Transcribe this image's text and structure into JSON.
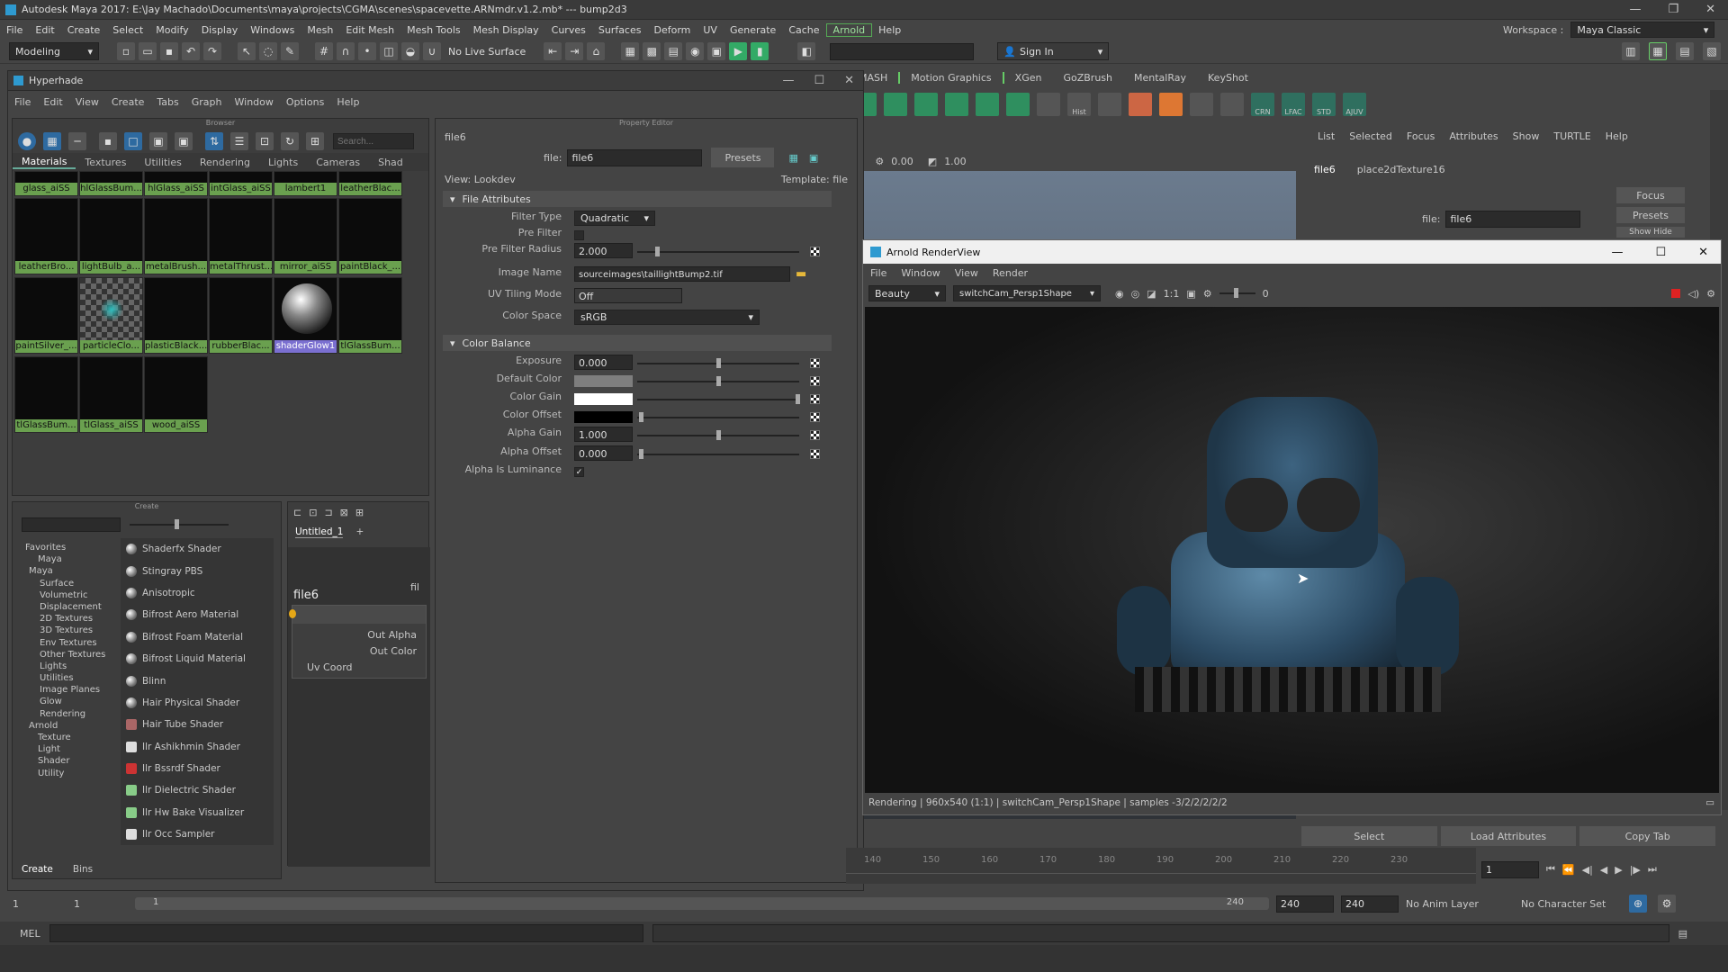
{
  "titlebar": {
    "title": "Autodesk Maya 2017: E:\\Jay Machado\\Documents\\maya\\projects\\CGMA\\scenes\\spacevette.ARNmdr.v1.2.mb*   ---   bump2d3"
  },
  "mainmenu": [
    "File",
    "Edit",
    "Create",
    "Select",
    "Modify",
    "Display",
    "Windows",
    "Mesh",
    "Edit Mesh",
    "Mesh Tools",
    "Mesh Display",
    "Curves",
    "Surfaces",
    "Deform",
    "UV",
    "Generate",
    "Cache",
    "Arnold",
    "Help"
  ],
  "statusline": {
    "mode": "Modeling",
    "live_surface": "No Live Surface",
    "sign_in": "Sign In",
    "workspace_label": "Workspace :",
    "workspace": "Maya Classic"
  },
  "shelf_tabs": [
    "MASH",
    "Motion Graphics",
    "XGen",
    "GoZBrush",
    "MentalRay",
    "KeyShot"
  ],
  "shelf_labels": [
    "Hist",
    "CRN",
    "LFAC",
    "STD",
    "AJUV"
  ],
  "hypershade": {
    "title": "Hyperhade",
    "menu": [
      "File",
      "Edit",
      "View",
      "Create",
      "Tabs",
      "Graph",
      "Window",
      "Options",
      "Help"
    ],
    "browser_label": "Browser",
    "search_placeholder": "Search...",
    "tabs": [
      "Materials",
      "Textures",
      "Utilities",
      "Rendering",
      "Lights",
      "Cameras",
      "Shad"
    ],
    "materials": [
      "glass_aiSS",
      "hlGlassBum...",
      "hlGlass_aiSS",
      "intGlass_aiSS",
      "lambert1",
      "leatherBlac...",
      "leatherBro...",
      "lightBulb_a...",
      "metalBrush...",
      "metalThrust...",
      "mirror_aiSS",
      "paintBlack_...",
      "paintSilver_...",
      "particleClo...",
      "plasticBlack...",
      "rubberBlac...",
      "shaderGlow1",
      "tlGlassBum...",
      "tlGlassBum...",
      "tlGlass_aiSS",
      "wood_aiSS"
    ],
    "create_label": "Create",
    "tree": [
      "Favorites",
      "Maya",
      "Maya",
      "Surface",
      "Volumetric",
      "Displacement",
      "2D Textures",
      "3D Textures",
      "Env Textures",
      "Other Textures",
      "Lights",
      "Utilities",
      "Image Planes",
      "Glow",
      "Rendering",
      "Arnold",
      "Texture",
      "Light",
      "Shader",
      "Utility"
    ],
    "shaders": [
      "Shaderfx Shader",
      "Stingray PBS",
      "Anisotropic",
      "Bifrost Aero Material",
      "Bifrost Foam Material",
      "Bifrost Liquid Material",
      "Blinn",
      "Hair Physical Shader",
      "Hair Tube Shader",
      "Ilr Ashikhmin Shader",
      "Ilr Bssrdf Shader",
      "Ilr Dielectric Shader",
      "Ilr Hw Bake Visualizer",
      "Ilr Occ Sampler"
    ],
    "bottom_tabs": [
      "Create",
      "Bins"
    ],
    "graph_tab": "Untitled_1",
    "node": {
      "name": "file6",
      "clip": "fil",
      "out_alpha": "Out Alpha",
      "out_color": "Out Color",
      "uv_coord": "Uv Coord"
    }
  },
  "property_editor": {
    "label": "Property Editor",
    "tab": "file6",
    "file_label": "file:",
    "file_value": "file6",
    "presets": "Presets",
    "view": "View: Lookdev",
    "template": "Template: file",
    "file_attributes": "File Attributes",
    "filter_type_label": "Filter Type",
    "filter_type": "Quadratic",
    "pre_filter_label": "Pre Filter",
    "pre_filter_radius_label": "Pre Filter Radius",
    "pre_filter_radius": "2.000",
    "image_name_label": "Image Name",
    "image_name": "sourceimages\\taillightBump2.tif",
    "uv_tiling_label": "UV Tiling Mode",
    "uv_tiling": "Off",
    "color_space_label": "Color Space",
    "color_space": "sRGB",
    "color_balance": "Color Balance",
    "exposure_label": "Exposure",
    "exposure": "0.000",
    "default_color_label": "Default Color",
    "color_gain_label": "Color Gain",
    "color_offset_label": "Color Offset",
    "alpha_gain_label": "Alpha Gain",
    "alpha_gain": "1.000",
    "alpha_offset_label": "Alpha Offset",
    "alpha_offset": "0.000",
    "alpha_is_luminance_label": "Alpha Is Luminance"
  },
  "viewport_bar": {
    "v1": "0.00",
    "v2": "1.00"
  },
  "attr_editor": {
    "menu": [
      "List",
      "Selected",
      "Focus",
      "Attributes",
      "Show",
      "TURTLE",
      "Help"
    ],
    "tab1": "file6",
    "tab2": "place2dTexture16",
    "file_label": "file:",
    "file_value": "file6",
    "focus": "Focus",
    "presets": "Presets",
    "show_hide": "Show   Hide",
    "select": "Select",
    "load_attributes": "Load Attributes",
    "copy_tab": "Copy Tab"
  },
  "renderview": {
    "title": "Arnold RenderView",
    "menu": [
      "File",
      "Window",
      "View",
      "Render"
    ],
    "aov": "Beauty",
    "camera": "switchCam_Persp1Shape",
    "ratio": "1:1",
    "exposure": "0",
    "status": "Rendering | 960x540 (1:1) | switchCam_Persp1Shape | samples -3/2/2/2/2/2"
  },
  "timeline": {
    "ticks": [
      "140",
      "150",
      "160",
      "170",
      "180",
      "190",
      "200",
      "210",
      "220",
      "230"
    ],
    "current_frame": "1",
    "range_start": "1",
    "range_start2": "1",
    "range_field": "1",
    "end1": "240",
    "end2": "240",
    "end3": "240",
    "anim_layer": "No Anim Layer",
    "character_set": "No Character Set"
  },
  "commandline": {
    "label": "MEL"
  },
  "colors": {
    "accent": "#5fb98a",
    "material_label": "#6aa04f",
    "selected_label": "#7a6fd0",
    "render_blue": "#2b4a63"
  }
}
